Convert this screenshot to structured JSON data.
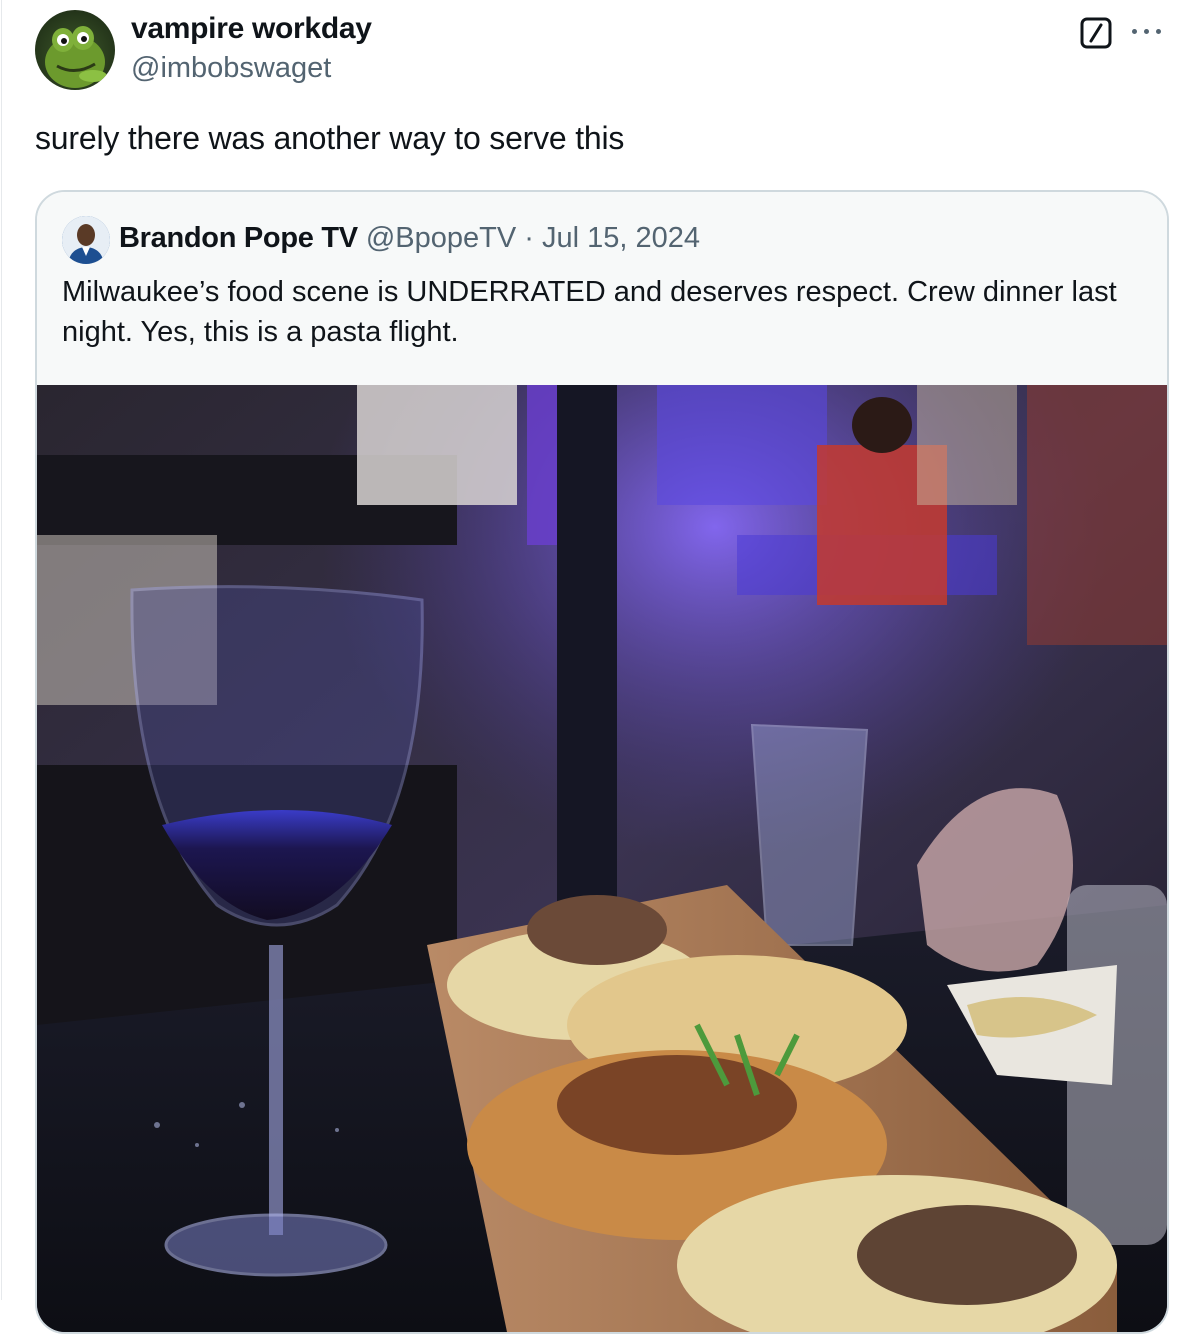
{
  "tweet": {
    "author": {
      "display_name": "vampire workday",
      "handle": "@imbobswaget"
    },
    "text": "surely there was another way to serve this",
    "icons": {
      "grok": "grok-icon",
      "more": "more-icon"
    }
  },
  "quoted_tweet": {
    "author": {
      "display_name": "Brandon Pope TV",
      "handle": "@BpopeTV",
      "separator": " · ",
      "date": "Jul 15, 2024"
    },
    "text": "Milwaukee’s food scene is UNDERRATED and deserves respect. Crew dinner last night. Yes, this is a pasta flight."
  }
}
